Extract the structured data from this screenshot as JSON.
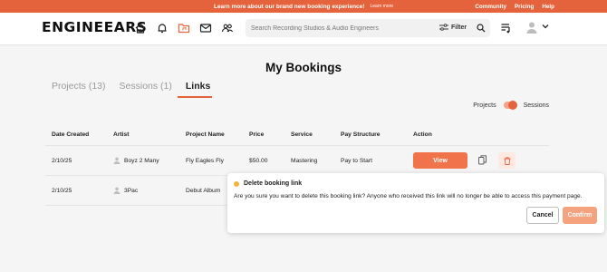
{
  "banner": {
    "message": "Learn more about our brand new booking experience!",
    "learn_more": "Learn more",
    "links": [
      "Community",
      "Pricing",
      "Help"
    ]
  },
  "header": {
    "logo": "ENGINEEARS",
    "search_placeholder": "Search Recording Studios & Audio Engineers",
    "filter_label": "Filter",
    "icons": [
      "home-icon",
      "bell-icon",
      "folder-icon",
      "mail-icon",
      "people-icon",
      "playlist-icon",
      "user-avatar-icon",
      "chevron-down-icon"
    ],
    "accent": "#e5633c"
  },
  "page": {
    "title": "My Bookings",
    "tabs": [
      {
        "label": "Projects (13)"
      },
      {
        "label": "Sessions (1)"
      },
      {
        "label": "Links"
      }
    ],
    "toggle": {
      "left": "Projects",
      "right": "Sessions"
    }
  },
  "table": {
    "headers": [
      "Date Created",
      "Artist",
      "Project Name",
      "Price",
      "Service",
      "Pay Structure",
      "Action"
    ],
    "rows": [
      {
        "date": "2/10/25",
        "artist": "Boyz 2 Many",
        "project": "Fly Eagles Fly",
        "price": "$50.00",
        "service": "Mastering",
        "pay": "Pay to Start",
        "action": "View"
      },
      {
        "date": "2/10/25",
        "artist": "3Pac",
        "project": "Debut Album"
      }
    ]
  },
  "dialog": {
    "title": "Delete booking link",
    "body": "Are you sure you want to delete this booking link? Anyone who received this link will no longer be able to access this payment page.",
    "cancel": "Cancel",
    "confirm": "Confirm"
  }
}
